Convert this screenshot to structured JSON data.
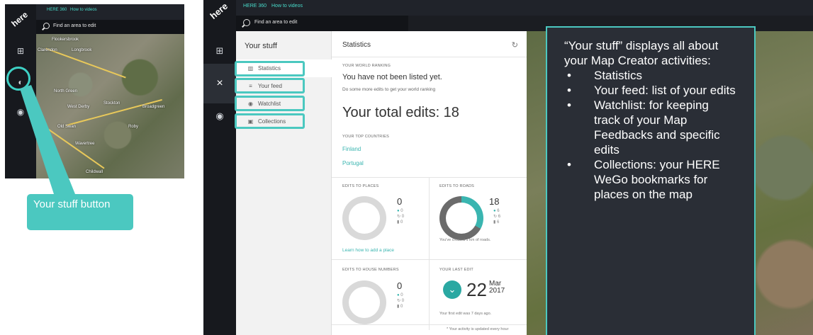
{
  "small_shot": {
    "logo": "here",
    "links": [
      "HERE 360",
      "How to videos"
    ],
    "search_placeholder": "Find an area to edit",
    "map_labels": [
      "Flookersbrook",
      "Clarendon",
      "Longbrook",
      "North Green",
      "West Derby",
      "Stockton",
      "Broadgreen",
      "Old Swan",
      "Roby",
      "Wavertree",
      "Childwall"
    ]
  },
  "callout": {
    "label": "Your stuff button"
  },
  "main_shot": {
    "logo": "here",
    "links": [
      "HERE 360",
      "How to videos"
    ],
    "search_placeholder": "Find an area to edit",
    "close_glyph": "×"
  },
  "your_stuff": {
    "title": "Your stuff",
    "items": [
      {
        "label": "Statistics",
        "icon": "bar-chart-icon"
      },
      {
        "label": "Your feed",
        "icon": "list-icon"
      },
      {
        "label": "Watchlist",
        "icon": "eye-icon"
      },
      {
        "label": "Collections",
        "icon": "bookmark-icon"
      }
    ]
  },
  "statistics": {
    "title": "Statistics",
    "ranking_label": "YOUR WORLD RANKING",
    "ranking_title": "You have not been listed yet.",
    "ranking_sub": "Do some more edits to get your world ranking",
    "total_edits": "Your total edits: 18",
    "countries_label": "YOUR TOP COUNTRIES",
    "countries": [
      "Finland",
      "Portugal"
    ],
    "places": {
      "label": "EDITS TO PLACES",
      "value": "0",
      "stats": [
        "0",
        "0",
        "0"
      ],
      "link": "Learn how to add a place"
    },
    "roads": {
      "label": "EDITS TO ROADS",
      "value": "18",
      "stats": [
        "6",
        "6",
        "6"
      ],
      "note": "You've created 1 km of roads.",
      "teal_fraction": 0.33
    },
    "house_numbers": {
      "label": "EDITS TO HOUSE NUMBERS",
      "value": "0",
      "stats": [
        "0",
        "0",
        "0"
      ]
    },
    "last_edit": {
      "label": "YOUR LAST EDIT",
      "day": "22",
      "month": "Mar",
      "year": "2017",
      "note": "Your first edit was 7 days ago."
    },
    "footer_note": "* Your activity is updated every hour"
  },
  "info_box": {
    "intro": "“Your stuff” displays all about your Map Creator activities:",
    "items": [
      "Statistics",
      "Your feed: list of your edits",
      "Watchlist: for keeping track of your Map Feedbacks and specific edits",
      "Collections: your HERE WeGo bookmarks for places on the map"
    ]
  }
}
